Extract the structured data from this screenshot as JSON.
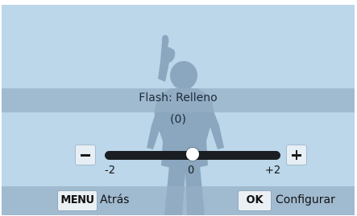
{
  "flash": {
    "mode_text": "Flash: Relleno",
    "value_text": "(0)"
  },
  "slider": {
    "min_label": "-2",
    "mid_label": "0",
    "max_label": "+2",
    "value": 0,
    "range": [
      -2,
      2
    ]
  },
  "bottom_bar": {
    "menu_key": "MENU",
    "menu_label": "Atrás",
    "ok_key": "OK",
    "ok_label": "Configurar"
  },
  "colors": {
    "screen_bg": "#bcd6ea",
    "silhouette": "#8aa7bf",
    "overlay": "#96afc6",
    "track": "#1a1e22"
  },
  "icons": [
    "minus-icon",
    "plus-icon"
  ]
}
